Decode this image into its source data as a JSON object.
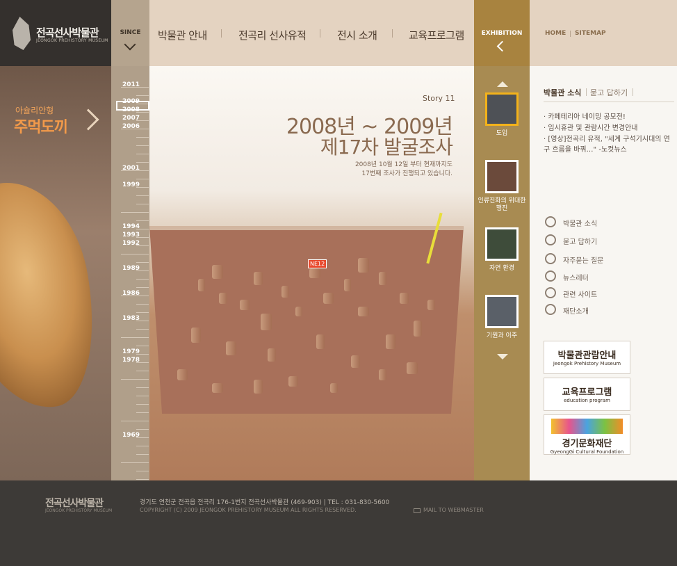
{
  "logo": {
    "title_ko": "전곡선사박물관",
    "title_en": "JEONGOK PREHISTORY MUSEUM"
  },
  "since_label": "SINCE",
  "nav": [
    "박물관 안내",
    "전곡리 선사유적",
    "전시 소개",
    "교육프로그램"
  ],
  "exhibition_label": "EXHIBITION",
  "util": {
    "home": "HOME",
    "sitemap": "SITEMAP"
  },
  "left_panel": {
    "sub": "아슐리안형",
    "main": "주먹도끼"
  },
  "timeline": {
    "years": [
      "2011",
      "2009",
      "2008",
      "2007",
      "2006",
      "2001",
      "1999",
      "1994",
      "1993",
      "1992",
      "1989",
      "1986",
      "1983",
      "1979",
      "1978",
      "1969"
    ],
    "selected": "2008"
  },
  "story": {
    "label": "Story 11",
    "title_line1": "2008년 ~ 2009년",
    "title_line2": "제17차 발굴조사",
    "desc_line1": "2008년 10월 12일 부터 현재까지도",
    "desc_line2": "17번째 조사가 진행되고 있습니다.",
    "tag": "NE12"
  },
  "exhibition_items": [
    {
      "label": "도입",
      "selected": true
    },
    {
      "label": "인류진화의 위대한 행진",
      "selected": false
    },
    {
      "label": "자연 환경",
      "selected": false
    },
    {
      "label": "기원과 이주",
      "selected": false
    }
  ],
  "right": {
    "tab_news": "박물관 소식",
    "tab_qa": "묻고 답하기",
    "news": [
      "카페테리아 네이밍 공모전!",
      "임시휴관 및 관람시간 변경안내",
      "[영상]전곡리 유적, \"세계 구석기시대의 연구 흐름을 바꿔…\" -노컷뉴스"
    ],
    "quick_links": [
      {
        "label": "박물관 소식",
        "icon": "microphone-icon"
      },
      {
        "label": "묻고 답하기",
        "icon": "question-icon"
      },
      {
        "label": "자주묻는 질문",
        "icon": "search-faq-icon"
      },
      {
        "label": "뉴스레터",
        "icon": "paper-plane-icon"
      },
      {
        "label": "관련 사이트",
        "icon": "browser-icon"
      },
      {
        "label": "재단소개",
        "icon": "building-icon"
      }
    ],
    "banners": [
      {
        "title": "박물관관람안내",
        "sub": "Jeongok Prehistory Museum"
      },
      {
        "title": "교육프로그램",
        "sub": "education program"
      },
      {
        "title": "경기문화재단",
        "sub": "GyeongGi Cultural Foundation"
      }
    ]
  },
  "footer": {
    "logo_ko": "전곡선사박물관",
    "logo_en": "JEONGOK PREHISTORY MUSEUM",
    "address": "경기도 연천군 전곡읍 전곡리 176-1번지 전곡선사박물관 (469-903)   |   TEL : 031-830-5600",
    "copyright": "COPYRIGHT (C) 2009 JEONGOK PREHISTORY MUSEUM ALL RIGHTS RESERVED.",
    "mail": "MAIL TO WEBMASTER"
  },
  "colors": {
    "accent": "#a8833f",
    "nav_bg": "#e4d3c1",
    "dark": "#34302d",
    "highlight": "#f39a4a"
  }
}
